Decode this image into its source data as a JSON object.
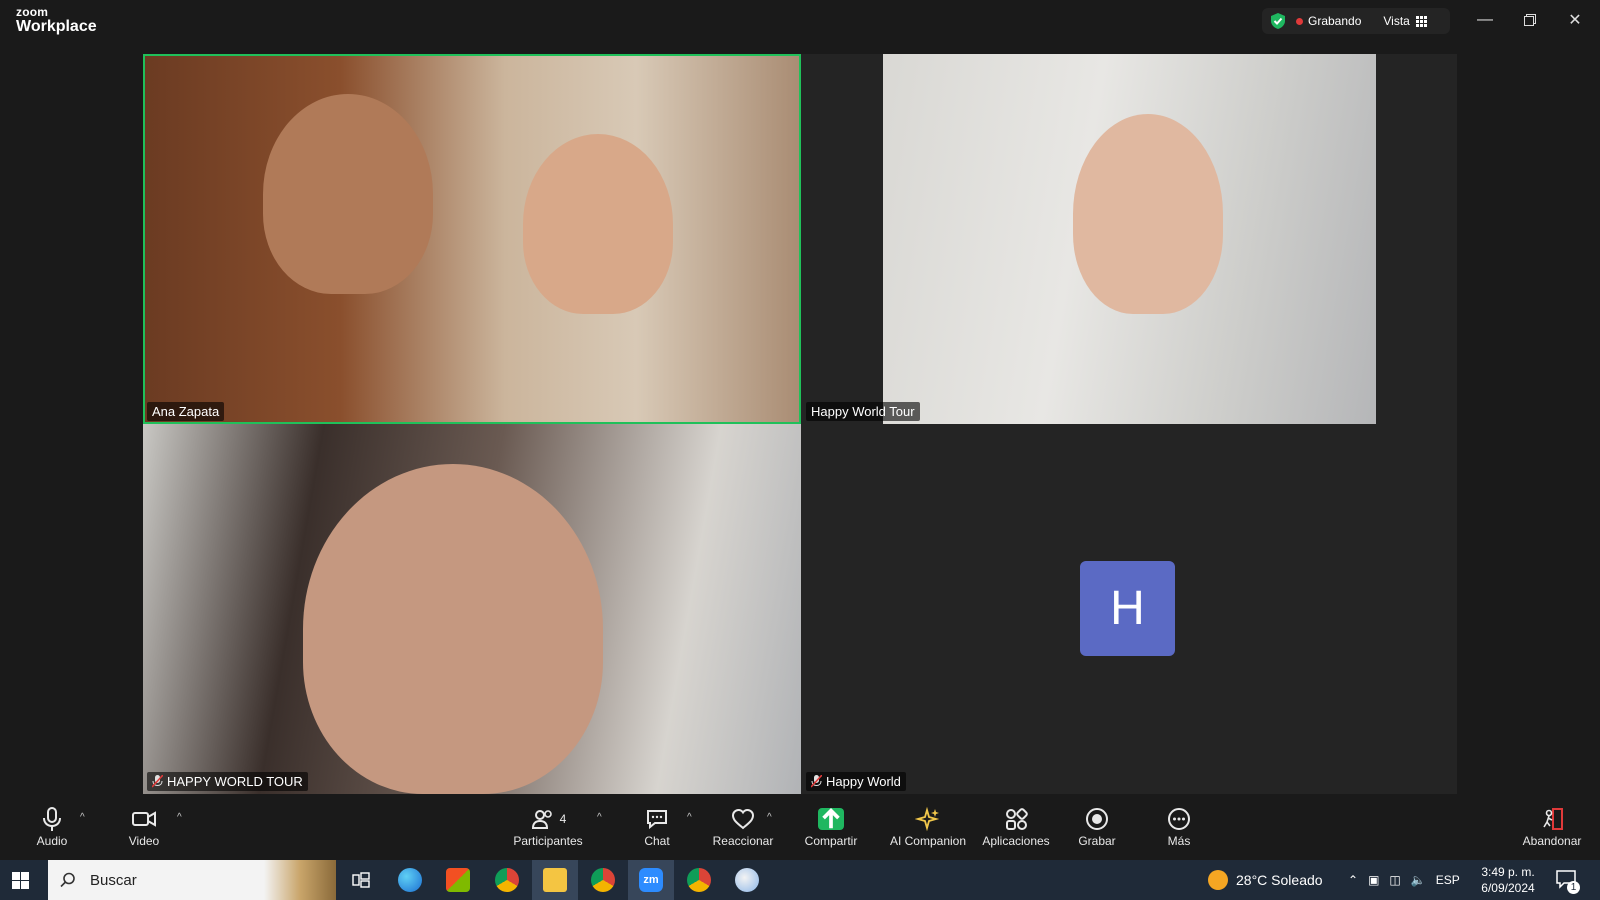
{
  "window": {
    "brand_small": "zoom",
    "brand_big": "Workplace"
  },
  "status": {
    "recording": "Grabando",
    "view": "Vista"
  },
  "tiles": [
    {
      "name": "Ana Zapata"
    },
    {
      "name": "Happy World Tour"
    },
    {
      "name": "HAPPY WORLD TOUR"
    },
    {
      "name": "Happy World",
      "avatar_letter": "H"
    }
  ],
  "toolbar": {
    "audio": "Audio",
    "video": "Video",
    "participants": "Participantes",
    "participants_count": "4",
    "chat": "Chat",
    "react": "Reaccionar",
    "share": "Compartir",
    "ai": "AI Companion",
    "apps": "Aplicaciones",
    "record": "Grabar",
    "more": "Más",
    "leave": "Abandonar"
  },
  "taskbar": {
    "search_placeholder": "Buscar",
    "weather": "28°C  Soleado",
    "lang": "ESP",
    "time": "3:49 p. m.",
    "date": "6/09/2024",
    "notif_count": "1"
  },
  "colors": {
    "accent_green": "#20c05a",
    "avatar_bg": "#5b6ac4",
    "share_green": "#1fb760",
    "rec_red": "#e03a3a"
  }
}
